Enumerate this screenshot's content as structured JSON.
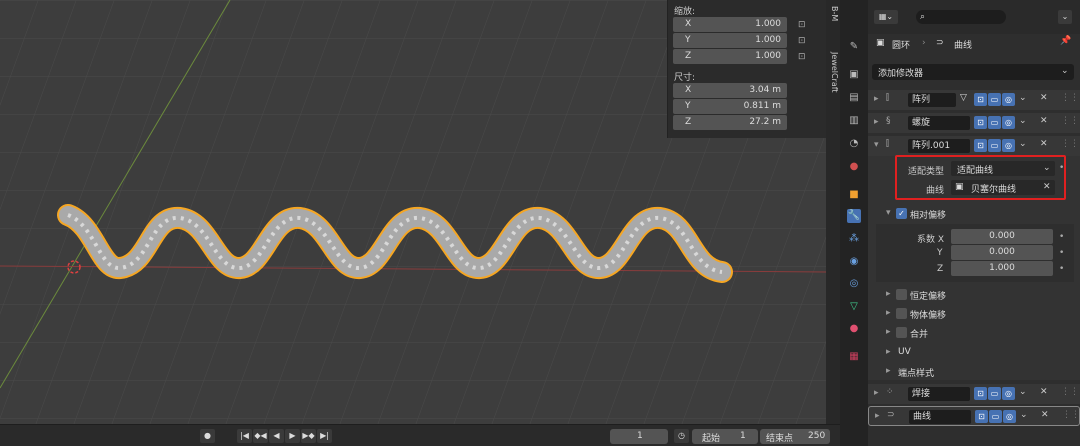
{
  "n_panel": {
    "scale_label": "缩放:",
    "scale": [
      {
        "axis": "X",
        "value": "1.000"
      },
      {
        "axis": "Y",
        "value": "1.000"
      },
      {
        "axis": "Z",
        "value": "1.000"
      }
    ],
    "dimensions_label": "尺寸:",
    "dimensions": [
      {
        "axis": "X",
        "value": "3.04 m"
      },
      {
        "axis": "Y",
        "value": "0.811 m"
      },
      {
        "axis": "Z",
        "value": "27.2 m"
      }
    ]
  },
  "side_tabs": [
    "B-M",
    "JewelCraft"
  ],
  "timeline": {
    "current_frame": "1",
    "start_label": "起始",
    "start": "1",
    "end_label": "结束点",
    "end": "250"
  },
  "properties": {
    "breadcrumb_object": "圆环",
    "breadcrumb_data": "曲线",
    "add_modifier": "添加修改器",
    "modifiers": [
      {
        "name": "阵列"
      },
      {
        "name": "螺旋"
      },
      {
        "name": "阵列.001"
      }
    ],
    "fit_type_label": "适配类型",
    "fit_type_value": "适配曲线",
    "curve_label": "曲线",
    "curve_value": "贝塞尔曲线",
    "relative_offset": "相对偏移",
    "factor_x_label": "系数 X",
    "factor_x": "0.000",
    "factor_y_label": "Y",
    "factor_y": "0.000",
    "factor_z_label": "Z",
    "factor_z": "1.000",
    "constant_offset": "恒定偏移",
    "object_offset": "物体偏移",
    "merge": "合并",
    "uv": "UV",
    "caps": "端点样式",
    "bottom_modifiers": [
      {
        "name": "焊接"
      },
      {
        "name": "曲线"
      }
    ]
  },
  "colors": {
    "accent": "#4772b3",
    "highlight_box": "#e02020",
    "selection_outline": "#f5a623"
  }
}
